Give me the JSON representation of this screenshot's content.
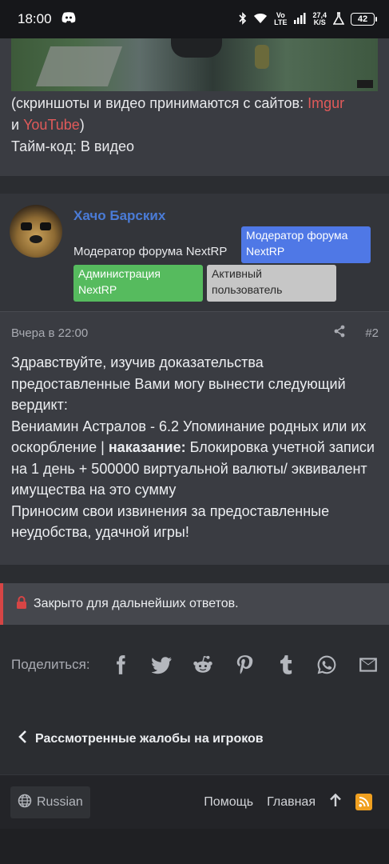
{
  "statusbar": {
    "time": "18:00",
    "net_top": "Vo",
    "net_bottom": "LTE",
    "speed_top": "27,4",
    "speed_bottom": "K/S",
    "battery": "42"
  },
  "prev_post": {
    "line1": "(скриншоты и видео принимаются с сайтов: ",
    "imgur": "Imgur",
    "line2_prefix": "и ",
    "youtube": "YouTube",
    "line2_suffix": ")",
    "line3": "Тайм-код: В видео"
  },
  "post": {
    "username": "Хачо Барских",
    "user_title": "Модератор форума NextRP",
    "badges": {
      "blue": "Модератор форума NextRP",
      "green": "Администрация NextRP",
      "grey": "Активный пользователь"
    },
    "date": "Вчера в 22:00",
    "number": "#2",
    "body_p1": "Здравствуйте, изучив доказательства предоставленные Вами могу вынести следующий вердикт:",
    "body_p2_pre": "Вениамин Астралов - 6.2 Упоминание родных или их оскорбление | ",
    "body_p2_bold": "наказание:",
    "body_p2_post": " Блокировка учетной записи на 1 день + 500000 виртуальной валюты/ эквивалент имущества на это сумму",
    "body_p3": "Приносим свои извинения за предоставленные неудобства, удачной игры!"
  },
  "locked": {
    "text": "Закрыто для дальнейших ответов."
  },
  "share": {
    "label": "Поделиться:"
  },
  "back": {
    "label": "Рассмотренные жалобы на игроков"
  },
  "footer": {
    "language": "Russian",
    "help": "Помощь",
    "home": "Главная"
  },
  "colors": {
    "accent_blue": "#4f78e6",
    "admin_green": "#56bb5e",
    "active_grey": "#c6c6c6",
    "link_red": "#e05a5a",
    "locked_red": "#d64545",
    "rss_orange": "#f0a020"
  },
  "icons": [
    "discord-icon",
    "bluetooth-icon",
    "wifi-icon",
    "signal-icon",
    "flask-icon",
    "share-icon",
    "lock-icon",
    "facebook-icon",
    "twitter-icon",
    "reddit-icon",
    "pinterest-icon",
    "tumblr-icon",
    "whatsapp-icon",
    "email-icon",
    "chevron-left-icon",
    "globe-icon",
    "arrow-up-icon",
    "rss-icon"
  ]
}
